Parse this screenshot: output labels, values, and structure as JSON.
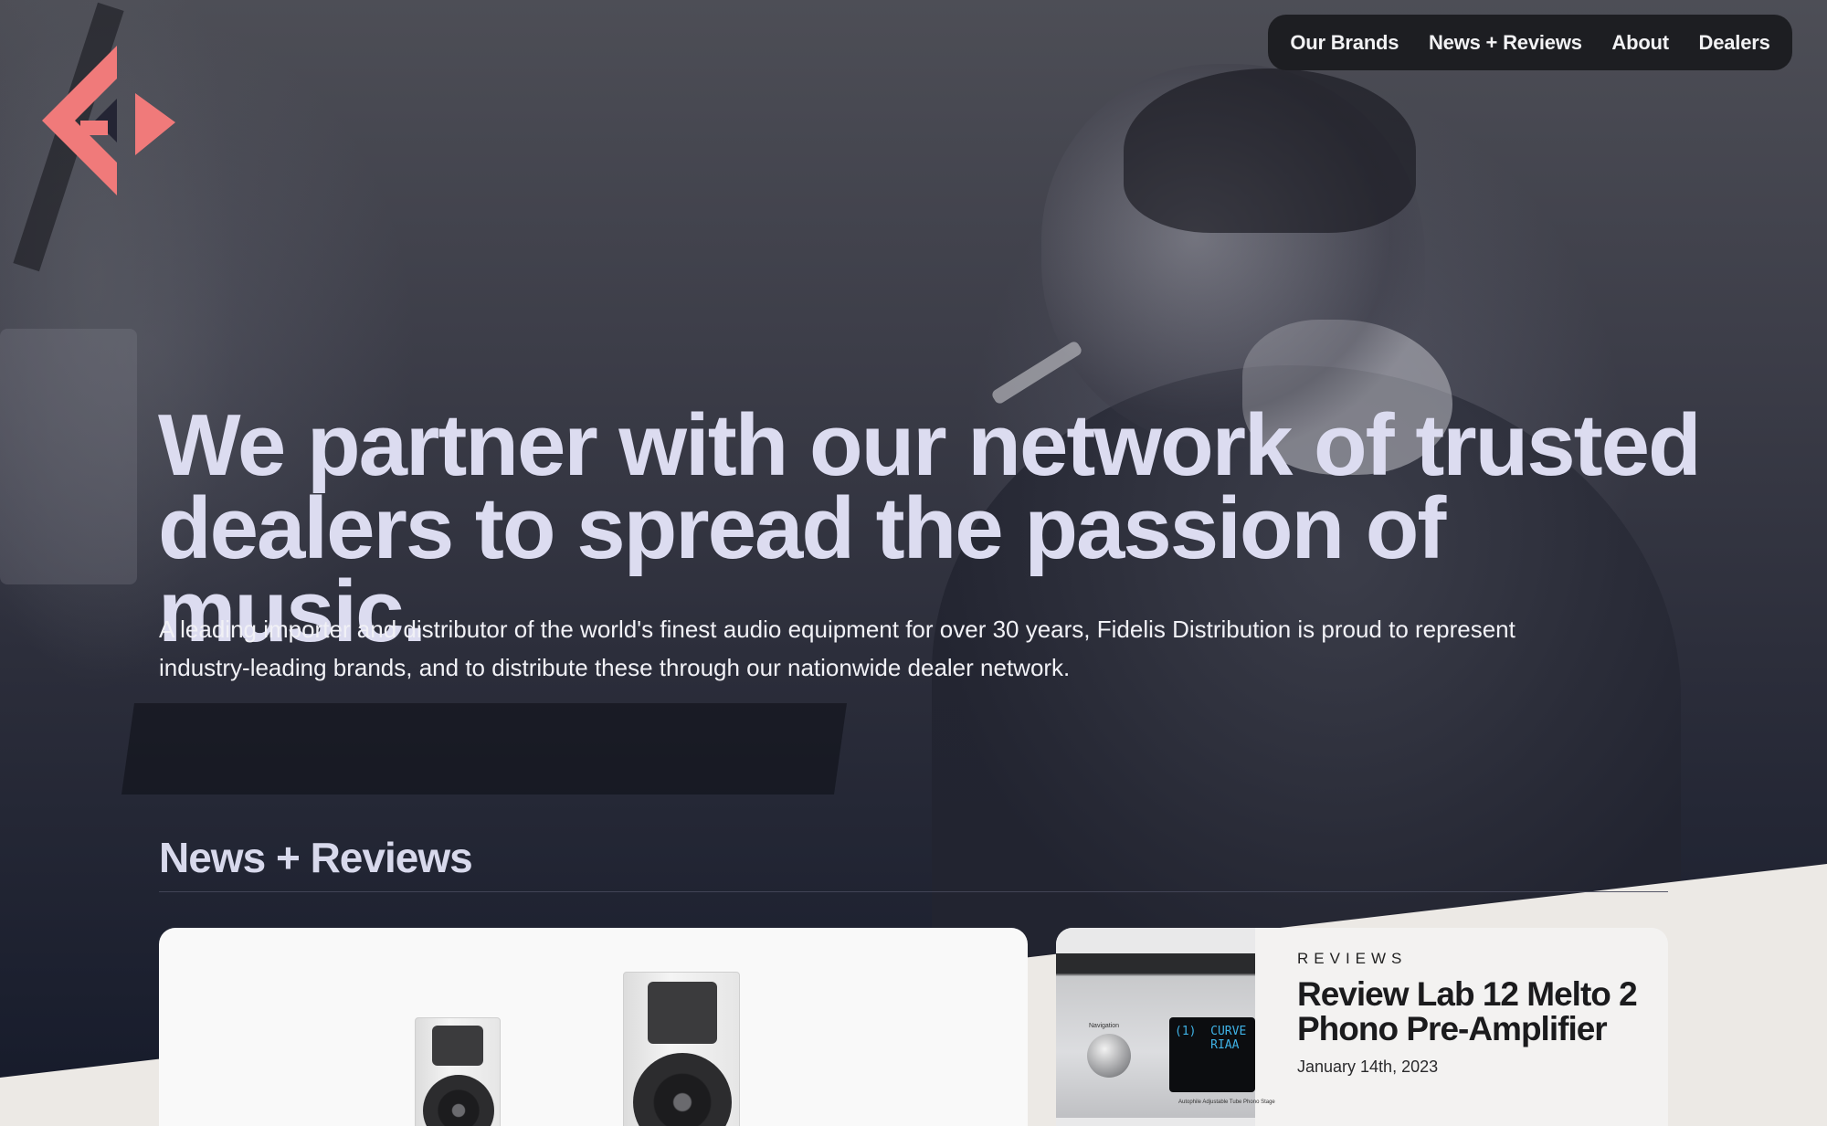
{
  "brand": {
    "logo_icon": "fidelis-f-logo",
    "accent_color": "#f07a7a"
  },
  "nav": {
    "items": [
      {
        "label": "Our Brands"
      },
      {
        "label": "News + Reviews"
      },
      {
        "label": "About"
      },
      {
        "label": "Dealers"
      }
    ]
  },
  "hero": {
    "headline_line1": "We partner with our network of trusted",
    "headline_line2": "dealers to spread the passion of music.",
    "intro_line1": "A leading importer and distributor of the world's finest audio equipment for over 30 years, Fidelis Distribution is proud to represent",
    "intro_line2": "industry-leading brands, and to distribute these through our nationwide dealer network."
  },
  "news": {
    "section_title": "News + Reviews",
    "cards": [
      {
        "image_icon": "bookshelf-speakers-image"
      },
      {
        "image_icon": "phono-preamp-image",
        "image_text": {
          "nav_label": "Navigation",
          "display_line1": "(1)  CURVE",
          "display_line2": "     RIAA",
          "caption": "Autophile Adjustable Tube Phono Stage"
        },
        "category": "REVIEWS",
        "title": "Review Lab 12 Melto 2 Phono Pre-Amplifier",
        "date": "January 14th, 2023"
      }
    ]
  }
}
